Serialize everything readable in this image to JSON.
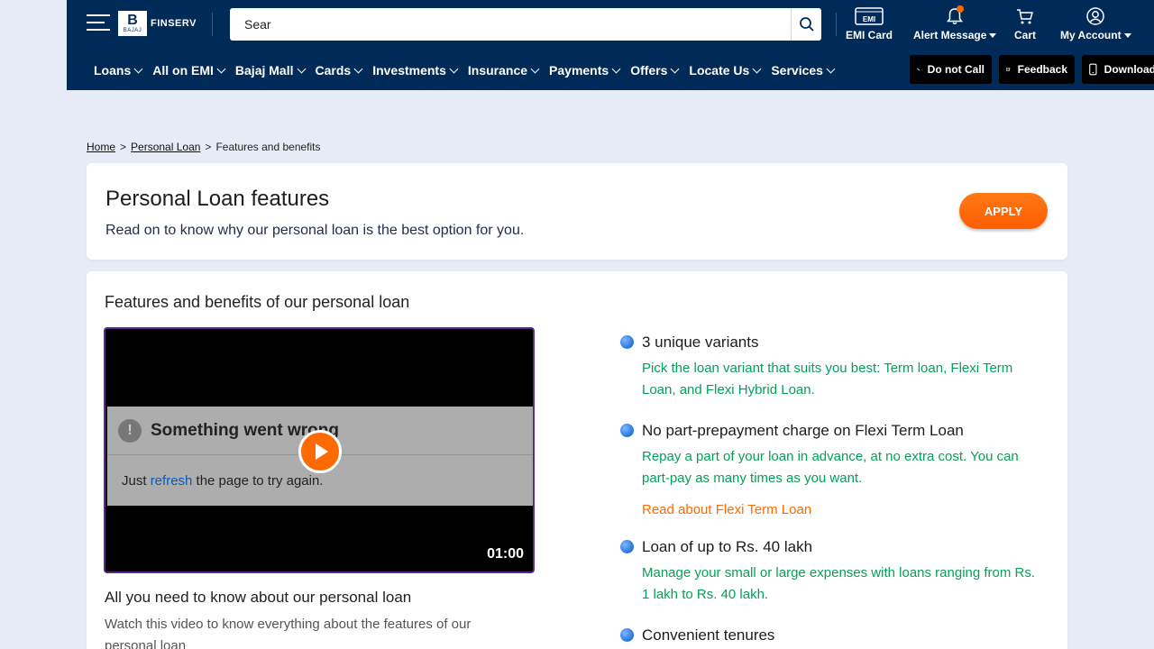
{
  "header": {
    "logo_text": "FINSERV",
    "logo_sub": "BAJAJ",
    "search": {
      "value": "Sear",
      "placeholder": "Search"
    },
    "actions": {
      "emi_card": "EMI Card",
      "emi_icon_text": "EMI",
      "alert": "Alert Message",
      "cart": "Cart",
      "account": "My Account"
    },
    "nav": [
      "Loans",
      "All on EMI",
      "Bajaj Mall",
      "Cards",
      "Investments",
      "Insurance",
      "Payments",
      "Offers",
      "Locate Us",
      "Services"
    ],
    "buttons": {
      "do_not_call": "Do not Call",
      "feedback": "Feedback",
      "download": "Download"
    }
  },
  "breadcrumb": {
    "home": "Home",
    "personal_loan": "Personal Loan",
    "current": "Features and benefits",
    "sep": ">"
  },
  "intro": {
    "title": "Personal Loan features",
    "subtitle": "Read on to know why our personal loan is the best option for you.",
    "apply": "APPLY"
  },
  "section": {
    "title": "Features and benefits of our personal loan",
    "video": {
      "error_title": "Something went wrong",
      "error_pre": "Just ",
      "error_link": "refresh",
      "error_post": " the page to try again.",
      "duration": "01:00",
      "title": "All you need to know about our personal loan",
      "desc": "Watch this video to know everything about the features of our personal loan"
    },
    "features": [
      {
        "title": "3 unique variants",
        "desc": "Pick the loan variant that suits you best: Term loan, Flexi Term Loan, and Flexi Hybrid Loan.",
        "link": ""
      },
      {
        "title": "No part-prepayment charge on Flexi Term Loan",
        "desc": "Repay a part of your loan in advance, at no extra cost. You can part-pay as many times as you want.",
        "link": "Read about Flexi Term Loan"
      },
      {
        "title": "Loan of up to Rs. 40 lakh",
        "desc": "Manage your small or large expenses with loans ranging from Rs. 1 lakh to Rs. 40 lakh.",
        "link": ""
      },
      {
        "title": "Convenient tenures",
        "desc": "",
        "link": ""
      }
    ]
  },
  "colors": {
    "header_bg": "#002a58",
    "accent": "#ff6a00",
    "feature_text": "#06a05a",
    "bullet": "#2f7de0"
  }
}
